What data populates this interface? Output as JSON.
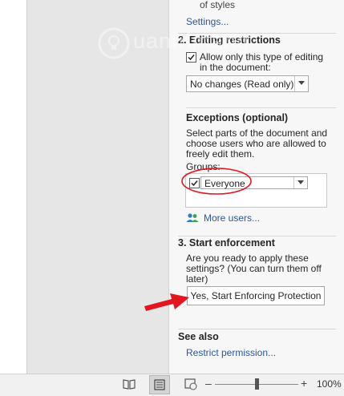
{
  "pane": {
    "top_partial": "of styles",
    "settings_link": "Settings...",
    "section2_heading": "2. Editing restrictions",
    "allow_label_line1": "Allow only this type of editing",
    "allow_label_line2": "in the document:",
    "editing_type_value": "No changes (Read only)",
    "exceptions_heading": "Exceptions (optional)",
    "exceptions_desc_line1": "Select parts of the document and",
    "exceptions_desc_line2": "choose users who are allowed to",
    "exceptions_desc_line3": "freely edit them.",
    "groups_label": "Groups:",
    "group_everyone": "Everyone",
    "more_users_link": "More users...",
    "section3_heading": "3. Start enforcement",
    "enforce_desc_line1": "Are you ready to apply these",
    "enforce_desc_line2": "settings? (You can turn them off",
    "enforce_desc_line3": "later)",
    "enforce_button": "Yes, Start Enforcing Protection",
    "see_also_heading": "See also",
    "restrict_permission_link": "Restrict permission..."
  },
  "statusbar": {
    "zoom_minus": "–",
    "zoom_plus": "+",
    "zoom_level": "100%",
    "zoom_fraction": 0.5
  },
  "watermark": {
    "text": "uantrimang"
  },
  "colors": {
    "annotation_red": "#e3161f",
    "link_blue": "#2b579a"
  },
  "icons": [
    "read-mode-icon",
    "print-layout-icon",
    "web-layout-icon",
    "users-icon",
    "chevron-down-icon",
    "checkmark-icon"
  ]
}
